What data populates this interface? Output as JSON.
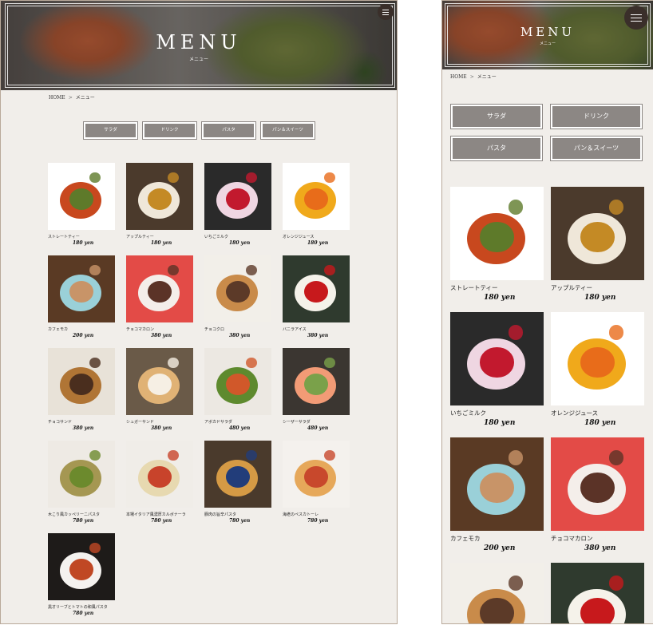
{
  "hero": {
    "title": "MENU",
    "subtitle": "メニュー"
  },
  "breadcrumb": {
    "home": "HOME",
    "separator": ">",
    "current": "メニュー"
  },
  "categories": [
    "サラダ",
    "ドリンク",
    "パスタ",
    "パン＆スイーツ"
  ],
  "currency_suffix": "yen",
  "items": [
    {
      "name": "ストレートティー",
      "price": "180 yen",
      "colors": [
        "#ffffff",
        "#c8481e",
        "#5e7a2a"
      ]
    },
    {
      "name": "アップルティー",
      "price": "180 yen",
      "colors": [
        "#4b3a2c",
        "#efe7d9",
        "#c48a25"
      ]
    },
    {
      "name": "いちごミルク",
      "price": "180 yen",
      "colors": [
        "#2a2a2a",
        "#efd6e2",
        "#c2192e"
      ]
    },
    {
      "name": "オレンジジュース",
      "price": "180 yen",
      "colors": [
        "#ffffff",
        "#f0a91b",
        "#e86c1a"
      ]
    },
    {
      "name": "カフェモカ",
      "price": "200 yen",
      "colors": [
        "#5a3a24",
        "#9ad0d8",
        "#c89468"
      ]
    },
    {
      "name": "チョコマカロン",
      "price": "380 yen",
      "colors": [
        "#e34b47",
        "#f4eeea",
        "#5b3327"
      ]
    },
    {
      "name": "チョコクロ",
      "price": "380 yen",
      "colors": [
        "#f2efe9",
        "#c98b4a",
        "#5c3a28"
      ]
    },
    {
      "name": "バニラアイス",
      "price": "380 yen",
      "colors": [
        "#2f3a2e",
        "#f5f2ea",
        "#c7191c"
      ]
    },
    {
      "name": "チョコサンド",
      "price": "380 yen",
      "colors": [
        "#e8e2d8",
        "#b07535",
        "#4a2e1e"
      ]
    },
    {
      "name": "シュガーサンド",
      "price": "380 yen",
      "colors": [
        "#6a5a48",
        "#e0b275",
        "#f6efe4"
      ]
    },
    {
      "name": "アボカドサラダ",
      "price": "480 yen",
      "colors": [
        "#ece8e2",
        "#5e8a2e",
        "#d1582a"
      ]
    },
    {
      "name": "シーザーサラダ",
      "price": "480 yen",
      "colors": [
        "#3b3631",
        "#f29b76",
        "#7aa14a"
      ]
    },
    {
      "name": "木こり風カッペリーニパスタ",
      "price": "780 yen",
      "colors": [
        "#eeeae4",
        "#a59752",
        "#6c8a2d"
      ]
    },
    {
      "name": "本場イタリア風濃厚カルボナーラ",
      "price": "780 yen",
      "colors": [
        "#f0ede8",
        "#e7d9b0",
        "#c8432b"
      ]
    },
    {
      "name": "豚肉の旨辛パスタ",
      "price": "780 yen",
      "colors": [
        "#4a3a2c",
        "#d59a45",
        "#223d7a"
      ]
    },
    {
      "name": "海老のペスカトーレ",
      "price": "780 yen",
      "colors": [
        "#f4f1ed",
        "#e6a85a",
        "#c8482c"
      ]
    },
    {
      "name": "黒オリーブとトマトの和風パスタ",
      "price": "780 yen",
      "colors": [
        "#1e1b19",
        "#f4f2ef",
        "#c04824"
      ]
    }
  ],
  "mobile": {
    "categories": [
      "サラダ",
      "ドリンク",
      "パスタ",
      "パン＆スイーツ"
    ],
    "items": [
      {
        "name": "ストレートティー",
        "price": "180 yen"
      },
      {
        "name": "アップルティー",
        "price": "180 yen"
      },
      {
        "name": "いちごミルク",
        "price": "180 yen"
      },
      {
        "name": "オレンジジュース",
        "price": "180 yen"
      },
      {
        "name": "カフェモカ",
        "price": "200 yen"
      },
      {
        "name": "チョコマカロン",
        "price": "380 yen"
      },
      {
        "name": "",
        "price": ""
      },
      {
        "name": "",
        "price": ""
      }
    ]
  }
}
